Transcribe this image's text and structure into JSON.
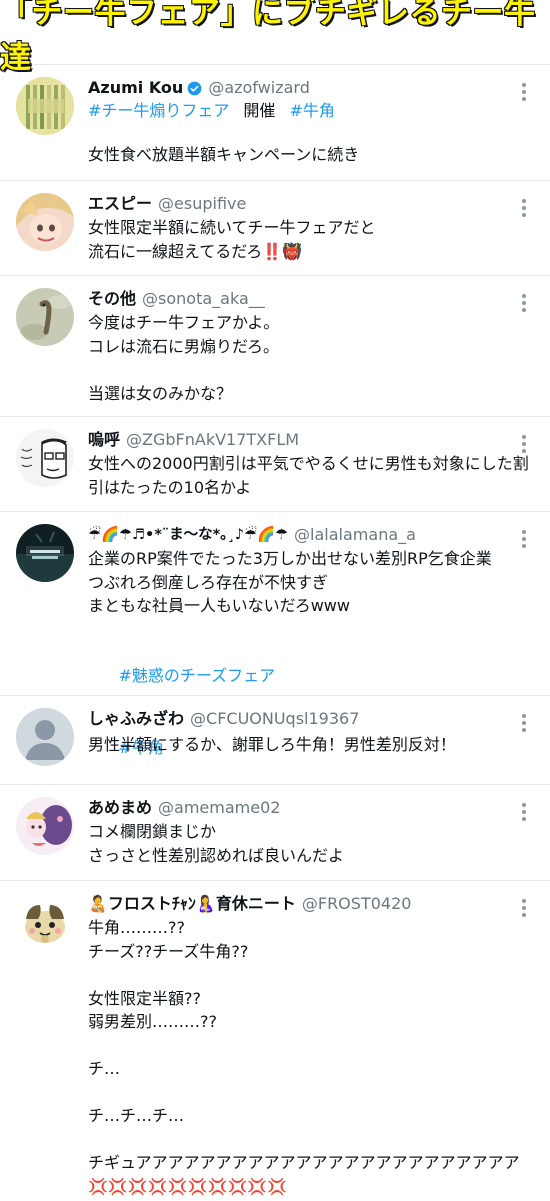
{
  "banner": {
    "title": "「チー牛フェア」にブチギレるチー牛達"
  },
  "tweets": [
    {
      "name": "Azumi Kou",
      "handle": "@azofwizard",
      "hashtag1": "#チー牛煽りフェア",
      "middle": "開催",
      "hashtag2": "#牛角",
      "body": "女性食べ放題半額キャンペーンに続き"
    },
    {
      "name": "エスピー",
      "handle": "@esupifive",
      "body": "女性限定半額に続いてチー牛フェアだと\n流石に一線超えてるだろ‼️👹"
    },
    {
      "name": "その他",
      "handle": "@sonota_aka__",
      "body": "今度はチー牛フェアかよ。\nコレは流石に男煽りだろ。\n\n当選は女のみかな？"
    },
    {
      "name": "嗚呼",
      "handle": "@ZGbFnAkV17TXFLM",
      "body": "女性への2000円割引は平気でやるくせに男性も対象にした割\n引はたったの10名かよ"
    },
    {
      "name": "☔🌈☂♬•*¨ま〜な*｡¸♪☔🌈☂",
      "handle": "@lalalamana_a",
      "body": "企業のRP案件でたった3万しか出せない差別RP乞食企業\nつぶれろ倒産しろ存在が不快すぎ\nまともな社員一人もいないだろwww",
      "hashtag1": "#魅惑のチーズフェア",
      "hashtag2": "#牛角"
    },
    {
      "name": "しゃふみざわ",
      "handle": "@CFCUONUqsl19367",
      "body": "男性半額にするか、謝罪しろ牛角！男性差別反対！"
    },
    {
      "name": "あめまめ",
      "handle": "@amemame02",
      "body": "コメ欄閉鎖まじか\nさっさと性差別認めれば良いんだよ"
    },
    {
      "name": "🧑‍🍼フロストﾁｬﾝ🤱育休ニート",
      "handle": "@FROST0420",
      "body": "牛角………??\nチーズ??チーズ牛角??\n\n女性限定半額??\n弱男差別………??\n\nチ…\n\nチ…チ…チ…\n\nチギュアアアアアアアアアアアアアアアアアアアアアアアア\n💢💢💢💢💢💢💢💢💢💢"
    }
  ]
}
